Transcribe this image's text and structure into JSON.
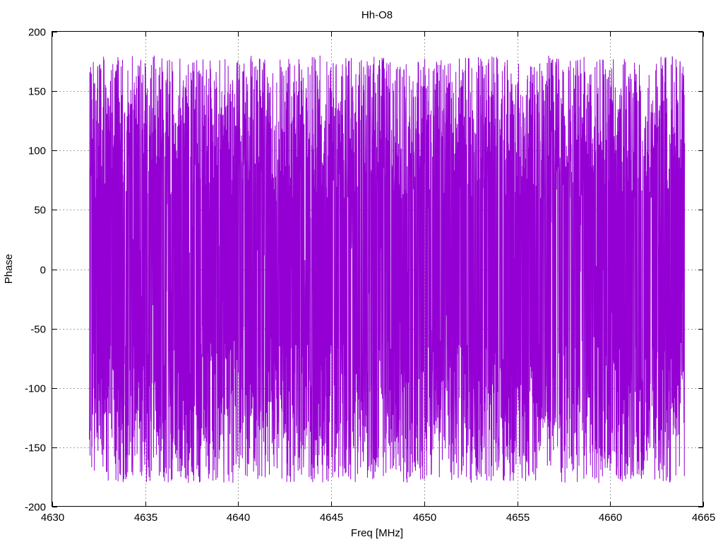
{
  "chart_data": {
    "type": "line",
    "title": "Hh-O8",
    "xlabel": "Freq [MHz]",
    "ylabel": "Phase",
    "xlim": [
      4630,
      4665
    ],
    "ylim": [
      -200,
      200
    ],
    "xticks": [
      "4630",
      "4635",
      "4640",
      "4645",
      "4650",
      "4655",
      "4660",
      "4665"
    ],
    "yticks": [
      "200",
      "150",
      "100",
      "50",
      "0",
      "-50",
      "-100",
      "-150",
      "-200"
    ],
    "grid": true,
    "series": [
      {
        "color": "#9400D3",
        "x_range": [
          4632,
          4664
        ],
        "description_values": {
          "min": -180,
          "max": 180,
          "approx_points": 4000
        }
      }
    ]
  }
}
